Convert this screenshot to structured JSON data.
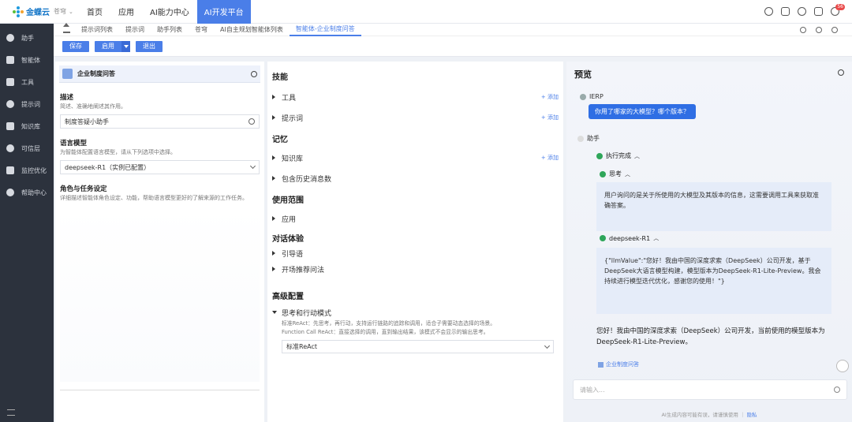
{
  "logo": {
    "name": "金蝶云",
    "sub": "苍穹"
  },
  "topnav": [
    {
      "label": "首页",
      "active": false
    },
    {
      "label": "应用",
      "active": false
    },
    {
      "label": "AI能力中心",
      "active": false
    },
    {
      "label": "AI开发平台",
      "active": true
    }
  ],
  "notifications": {
    "count": "56"
  },
  "sidebar": {
    "items": [
      {
        "label": "助手",
        "icon": "chat-icon"
      },
      {
        "label": "智能体",
        "icon": "cube-icon"
      },
      {
        "label": "工具",
        "icon": "puzzle-icon"
      },
      {
        "label": "提示词",
        "icon": "tag-icon"
      },
      {
        "label": "知识库",
        "icon": "database-icon"
      },
      {
        "label": "可信层",
        "icon": "shield-icon"
      },
      {
        "label": "监控优化",
        "icon": "monitor-icon"
      },
      {
        "label": "帮助中心",
        "icon": "help-icon"
      }
    ]
  },
  "subtabs": [
    {
      "label": "提示词列表",
      "active": false
    },
    {
      "label": "提示词",
      "active": false
    },
    {
      "label": "助手列表",
      "active": false
    },
    {
      "label": "苍穹",
      "active": false
    },
    {
      "label": "AI自主规划智能体列表",
      "active": false
    },
    {
      "label": "智能体-企业制度问答",
      "active": true
    }
  ],
  "actions": {
    "save": "保存",
    "publish": "启用",
    "exit": "退出"
  },
  "left": {
    "agent_name": "企业制度问答",
    "desc_title": "描述",
    "desc_hint": "简述、准确地阐述其作用。",
    "desc_value": "制度答疑小助手",
    "model_title": "语言模型",
    "model_hint": "为智能体配置语言模型，请从下列选项中选择。",
    "model_value": "deepseek-R1（实例已配置）",
    "role_title": "角色与任务设定",
    "role_hint": "详细描述智能体角色设定、功能，帮助语言模型更好的了解来源的工作任务。"
  },
  "mid": {
    "skills_title": "技能",
    "tools": "工具",
    "prompts": "提示词",
    "add": "+ 添加",
    "memory_title": "记忆",
    "knowledge": "知识库",
    "history": "包含历史消息数",
    "scope_title": "使用范围",
    "apps": "应用",
    "dialog_title": "对话体验",
    "guide": "引导语",
    "recommend": "开场推荐问法",
    "advanced_title": "高级配置",
    "mode_label": "思考和行动模式",
    "mode_hint1": "标准ReAct：先思考，再行动，支持运行链路的追踪和调用，适合子需要动态选择的场景。",
    "mode_hint2": "Function Call ReAct：直接选择的调用，直到输出结果，该模式不会显示的输出思考。",
    "mode_value": "标准ReAct"
  },
  "preview": {
    "title": "预览",
    "user_name": "IERP",
    "user_msg": "你用了哪家的大模型？哪个版本？",
    "assistant_name": "助手",
    "exec_done": "执行完成",
    "think_label": "思考",
    "think_text": "用户询问的是关于所使用的大模型及其版本的信息，这需要调用工具来获取准确答案。",
    "model_label": "deepseek-R1",
    "model_text": "{\"llmValue\":\"您好！我由中国的深度求索（DeepSeek）公司开发，基于DeepSeek大语言模型构建，模型版本为DeepSeek-R1-Lite-Preview。我会持续进行模型迭代优化，感谢您的使用！\"}",
    "final_text": "您好！我由中国的深度求索（DeepSeek）公司开发，当前使用的模型版本为DeepSeek-R1-Lite-Preview。",
    "ref_label": "企业制度问答",
    "input_placeholder": "请输入...",
    "disclaimer": "AI生成内容可能有误，请谨慎使用",
    "disclaimer_link": "隐私"
  }
}
